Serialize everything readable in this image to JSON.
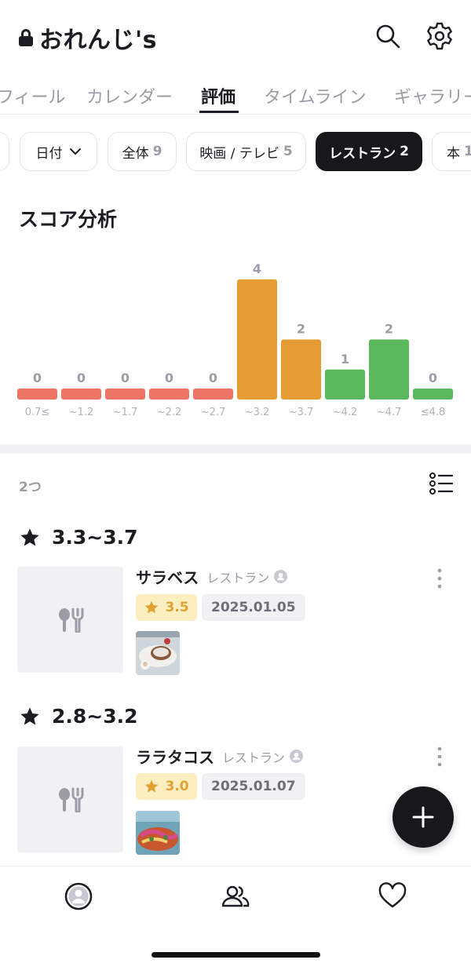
{
  "header": {
    "title": "おれんじ's",
    "search_icon": "search-icon",
    "settings_icon": "gear-icon"
  },
  "tabs": [
    {
      "label": "フィール",
      "active": false
    },
    {
      "label": "カレンダー",
      "active": false
    },
    {
      "label": "評価",
      "active": true
    },
    {
      "label": "タイムライン",
      "active": false
    },
    {
      "label": "ギャラリー",
      "active": false
    }
  ],
  "filters": {
    "sort_label": "日付",
    "chips": [
      {
        "label": "全体",
        "count": "9",
        "active": false
      },
      {
        "label": "映画 / テレビ",
        "count": "5",
        "active": false
      },
      {
        "label": "レストラン",
        "count": "2",
        "active": true
      },
      {
        "label": "本",
        "count": "1",
        "active": false
      }
    ]
  },
  "score_section": {
    "title": "スコア分析"
  },
  "chart_data": {
    "type": "bar",
    "categories": [
      "0.7≤",
      "~1.2",
      "~1.7",
      "~2.2",
      "~2.7",
      "~3.2",
      "~3.7",
      "~4.2",
      "~4.7",
      "≤4.8"
    ],
    "values": [
      0,
      0,
      0,
      0,
      0,
      4,
      2,
      1,
      2,
      0
    ],
    "colors": [
      "#ec7463",
      "#ec7463",
      "#ec7463",
      "#ec7463",
      "#ec7463",
      "#e59c34",
      "#e59c34",
      "#5cb85c",
      "#5cb85c",
      "#5cb85c"
    ],
    "ylim": [
      0,
      4
    ]
  },
  "list": {
    "count_label": "2つ",
    "groups": [
      {
        "range_label": "3.3~3.7",
        "entry": {
          "name": "サラベス",
          "category": "レストラン",
          "rating": "3.5",
          "date": "2025.01.05"
        }
      },
      {
        "range_label": "2.8~3.2",
        "entry": {
          "name": "ララタコス",
          "category": "レストラン",
          "rating": "3.0",
          "date": "2025.01.07"
        }
      }
    ]
  },
  "colors": {
    "accent_dark": "#17171c",
    "rating_yellow": "#e2a131",
    "rating_bg": "#fbefc1",
    "muted": "#9c9ca6"
  },
  "bottom_nav": [
    "profile-icon",
    "friends-icon",
    "heart-icon"
  ]
}
